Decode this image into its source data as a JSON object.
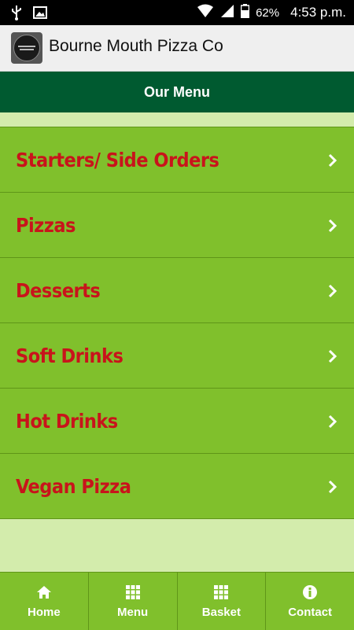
{
  "status_bar": {
    "battery": "62%",
    "time": "4:53 p.m."
  },
  "app_bar": {
    "title": "Bourne Mouth Pizza Co"
  },
  "page_header": {
    "title": "Our Menu"
  },
  "menu": {
    "items": [
      {
        "label": "Starters/ Side Orders"
      },
      {
        "label": "Pizzas"
      },
      {
        "label": "Desserts"
      },
      {
        "label": "Soft Drinks"
      },
      {
        "label": "Hot Drinks"
      },
      {
        "label": "Vegan Pizza"
      }
    ]
  },
  "bottom_nav": {
    "items": [
      {
        "label": "Home",
        "icon": "home-icon"
      },
      {
        "label": "Menu",
        "icon": "grid-icon"
      },
      {
        "label": "Basket",
        "icon": "grid-icon"
      },
      {
        "label": "Contact",
        "icon": "info-icon"
      }
    ]
  },
  "colors": {
    "header_green": "#005a30",
    "menu_green": "#80c02c",
    "label_red": "#c8141b",
    "background": "#d3ecac"
  }
}
